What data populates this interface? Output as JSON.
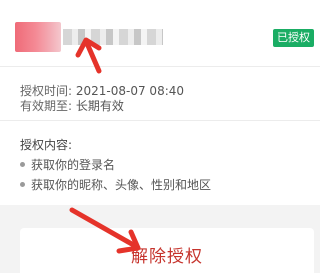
{
  "app": {
    "status_badge": "已授权"
  },
  "auth_info": {
    "time_label": "授权时间:",
    "time_value": "2021-08-07 08:40",
    "validity_label": "有效期至:",
    "validity_value": "长期有效"
  },
  "permissions": {
    "title": "授权内容:",
    "items": [
      {
        "label": "获取你的登录名"
      },
      {
        "label": "获取你的昵称、头像、性别和地区"
      }
    ]
  },
  "actions": {
    "revoke_label": "解除授权"
  },
  "colors": {
    "badge_green": "#1aad64",
    "revoke_red": "#c6342d",
    "arrow_red": "#e5332a"
  }
}
